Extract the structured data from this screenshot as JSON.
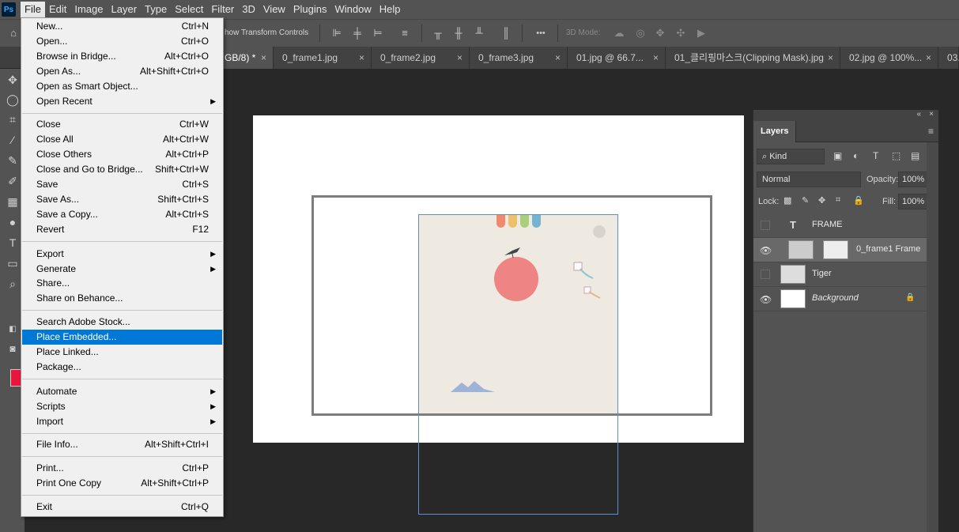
{
  "app": {
    "logo": "Ps"
  },
  "menubar": [
    "File",
    "Edit",
    "Image",
    "Layer",
    "Type",
    "Select",
    "Filter",
    "3D",
    "View",
    "Plugins",
    "Window",
    "Help"
  ],
  "options": {
    "show_transform": "how Transform Controls",
    "three_d_mode": "3D Mode:",
    "more": "•••"
  },
  "tabs": [
    {
      "label": "GB/8) *",
      "active": true
    },
    {
      "label": "0_frame1.jpg"
    },
    {
      "label": "0_frame2.jpg"
    },
    {
      "label": "0_frame3.jpg"
    },
    {
      "label": "01.jpg @ 66.7..."
    },
    {
      "label": "01_클리핑마스크(Clipping Mask).jpg"
    },
    {
      "label": "02.jpg @ 100%..."
    },
    {
      "label": "03."
    }
  ],
  "colors": {
    "foreground": "#e8163e",
    "canvas_bg": "#efeae1",
    "sun": "#ee8484",
    "highlight": "#0078d7"
  },
  "file_menu": {
    "groups": [
      [
        {
          "label": "New...",
          "shortcut": "Ctrl+N"
        },
        {
          "label": "Open...",
          "shortcut": "Ctrl+O"
        },
        {
          "label": "Browse in Bridge...",
          "shortcut": "Alt+Ctrl+O"
        },
        {
          "label": "Open As...",
          "shortcut": "Alt+Shift+Ctrl+O"
        },
        {
          "label": "Open as Smart Object...",
          "shortcut": ""
        },
        {
          "label": "Open Recent",
          "shortcut": "",
          "submenu": true
        }
      ],
      [
        {
          "label": "Close",
          "shortcut": "Ctrl+W"
        },
        {
          "label": "Close All",
          "shortcut": "Alt+Ctrl+W"
        },
        {
          "label": "Close Others",
          "shortcut": "Alt+Ctrl+P"
        },
        {
          "label": "Close and Go to Bridge...",
          "shortcut": "Shift+Ctrl+W"
        },
        {
          "label": "Save",
          "shortcut": "Ctrl+S"
        },
        {
          "label": "Save As...",
          "shortcut": "Shift+Ctrl+S"
        },
        {
          "label": "Save a Copy...",
          "shortcut": "Alt+Ctrl+S"
        },
        {
          "label": "Revert",
          "shortcut": "F12"
        }
      ],
      [
        {
          "label": "Export",
          "shortcut": "",
          "submenu": true
        },
        {
          "label": "Generate",
          "shortcut": "",
          "submenu": true
        },
        {
          "label": "Share...",
          "shortcut": ""
        },
        {
          "label": "Share on Behance...",
          "shortcut": ""
        }
      ],
      [
        {
          "label": "Search Adobe Stock...",
          "shortcut": ""
        },
        {
          "label": "Place Embedded...",
          "shortcut": "",
          "highlighted": true
        },
        {
          "label": "Place Linked...",
          "shortcut": ""
        },
        {
          "label": "Package...",
          "shortcut": ""
        }
      ],
      [
        {
          "label": "Automate",
          "shortcut": "",
          "submenu": true
        },
        {
          "label": "Scripts",
          "shortcut": "",
          "submenu": true
        },
        {
          "label": "Import",
          "shortcut": "",
          "submenu": true
        }
      ],
      [
        {
          "label": "File Info...",
          "shortcut": "Alt+Shift+Ctrl+I"
        }
      ],
      [
        {
          "label": "Print...",
          "shortcut": "Ctrl+P"
        },
        {
          "label": "Print One Copy",
          "shortcut": "Alt+Shift+Ctrl+P"
        }
      ],
      [
        {
          "label": "Exit",
          "shortcut": "Ctrl+Q"
        }
      ]
    ]
  },
  "layers_panel": {
    "tab": "Layers",
    "filter_kind": "Kind",
    "blend_mode": "Normal",
    "opacity_label": "Opacity:",
    "opacity": "100%",
    "lock_label": "Lock:",
    "fill_label": "Fill:",
    "fill": "100%",
    "layers": [
      {
        "name": "FRAME",
        "type": "text",
        "visible": false,
        "selected": false
      },
      {
        "name": "0_frame1 Frame",
        "type": "frame",
        "visible": true,
        "selected": true
      },
      {
        "name": "Tiger",
        "type": "image",
        "visible": false,
        "selected": false
      },
      {
        "name": "Background",
        "type": "background",
        "visible": true,
        "selected": false,
        "locked": true
      }
    ]
  }
}
